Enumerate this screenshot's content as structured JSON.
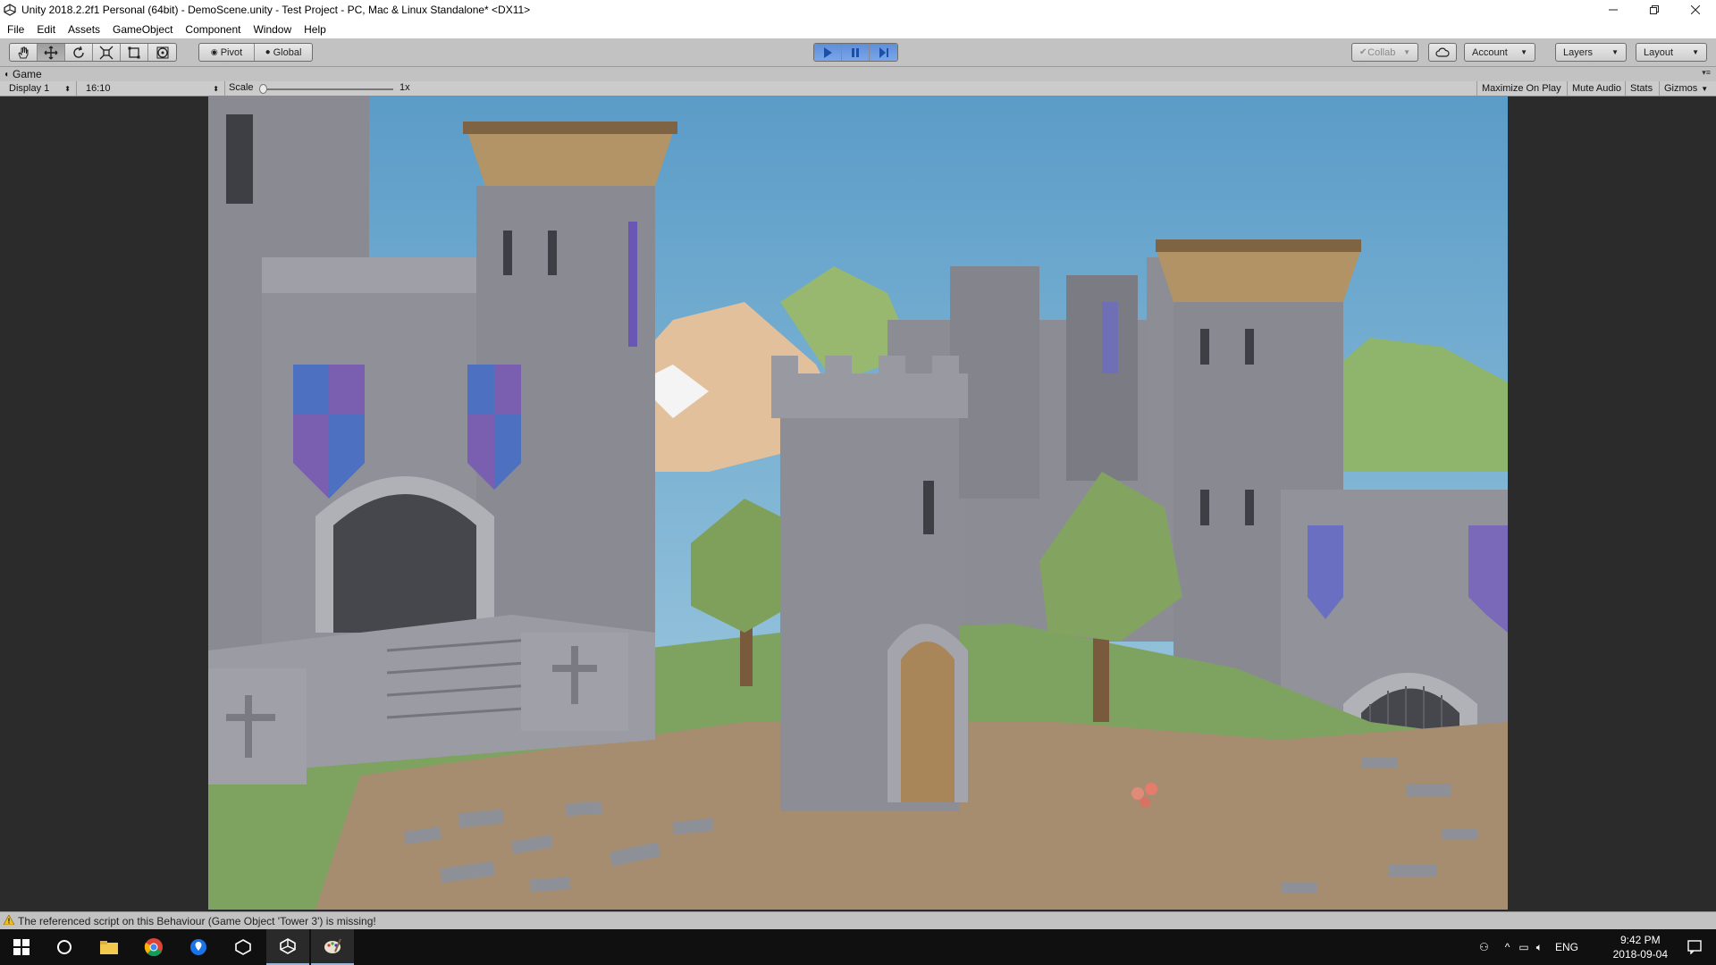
{
  "window": {
    "title": "Unity 2018.2.2f1 Personal (64bit) - DemoScene.unity - Test Project - PC, Mac & Linux Standalone* <DX11>",
    "controls": [
      "minimize",
      "restore",
      "close"
    ]
  },
  "menubar": {
    "items": [
      "File",
      "Edit",
      "Assets",
      "GameObject",
      "Component",
      "Window",
      "Help"
    ]
  },
  "toolbar": {
    "tools": [
      "hand-tool",
      "move-tool",
      "rotate-tool",
      "scale-tool",
      "rect-tool",
      "transform-tool"
    ],
    "active_tool": "move-tool",
    "pivot_label": "Pivot",
    "global_label": "Global",
    "play_state": "playing",
    "collab_label": "Collab",
    "account_label": "Account",
    "layers_label": "Layers",
    "layout_label": "Layout"
  },
  "game_panel": {
    "tab_label": "Game",
    "display_label": "Display 1",
    "aspect_label": "16:10",
    "scale_label": "Scale",
    "scale_value": "1x",
    "scale_slider_level": 0.0,
    "maximize_label": "Maximize On Play",
    "mute_label": "Mute Audio",
    "stats_label": "Stats",
    "gizmos_label": "Gizmos"
  },
  "scene": {
    "description_colors": {
      "sky_top": "#5f9ec9",
      "sky_bottom": "#9fcbe0",
      "stone": "#8e8f96",
      "stone_dark": "#6d6e75",
      "grass": "#7fa463",
      "dirt": "#a38a6e",
      "wood": "#a88a62",
      "banner_blue": "#4d6fbf",
      "banner_purple": "#8a5fa8"
    }
  },
  "statusbar": {
    "message": "The referenced script on this Behaviour (Game Object 'Tower 3') is missing!"
  },
  "taskbar": {
    "apps": [
      "start-icon",
      "cortana-icon",
      "file-explorer-icon",
      "chrome-icon",
      "maps-icon",
      "unity-hub-icon",
      "unity-icon",
      "paint-icon"
    ],
    "language": "ENG",
    "time": "9:42 PM",
    "date": "2018-09-04"
  }
}
